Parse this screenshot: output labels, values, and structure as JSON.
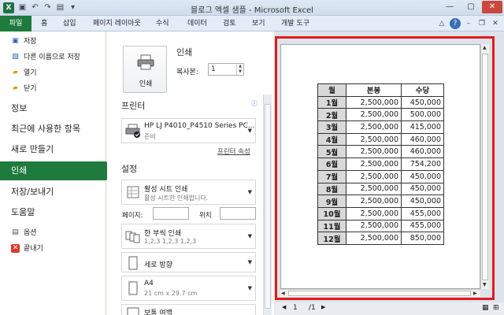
{
  "window": {
    "title": "블로그 엑셀 샘플 - Microsoft Excel",
    "app_icon": "X"
  },
  "ribbon": {
    "file_tab": "파일",
    "tabs": [
      "홈",
      "삽입",
      "페이지 레이아웃",
      "수식",
      "데이터",
      "검토",
      "보기",
      "개발 도구"
    ]
  },
  "backstage": {
    "save": "저장",
    "save_as": "다른 이름으로 저장",
    "open": "열기",
    "close": "닫기",
    "info": "정보",
    "recent": "최근에 사용한 항목",
    "new": "새로 만들기",
    "print": "인쇄",
    "save_send": "저장/보내기",
    "help": "도움말",
    "options": "옵션",
    "exit": "끝내기"
  },
  "print_pane": {
    "heading": "인쇄",
    "print_button": "인쇄",
    "copies_label": "복사본:",
    "copies_value": "1",
    "printer_heading": "프린터",
    "printer_name": "HP LJ P4010_P4510 Series PC...",
    "printer_status": "준비",
    "printer_properties": "프린터 속성",
    "settings_heading": "설정",
    "scope_main": "활성 시트 인쇄",
    "scope_sub": "활성 시트만 인쇄합니다.",
    "pages_label": "페이지:",
    "to_label": "위치",
    "collate_main": "한 부씩 인쇄",
    "collate_sub": "1,2,3    1,2,3    1,2,3",
    "orientation": "세로 방향",
    "paper_main": "A4",
    "paper_sub": "21 cm x 29.7 cm",
    "margins": "보통 여백"
  },
  "preview": {
    "headers": [
      "월",
      "본봉",
      "수당"
    ],
    "rows": [
      [
        "1월",
        "2,500,000",
        "450,000"
      ],
      [
        "2월",
        "2,500,000",
        "500,000"
      ],
      [
        "3월",
        "2,500,000",
        "415,000"
      ],
      [
        "4월",
        "2,500,000",
        "460,000"
      ],
      [
        "5월",
        "2,500,000",
        "460,000"
      ],
      [
        "6월",
        "2,500,000",
        "754,200"
      ],
      [
        "7월",
        "2,500,000",
        "450,000"
      ],
      [
        "8월",
        "2,500,000",
        "450,000"
      ],
      [
        "9월",
        "2,500,000",
        "450,000"
      ],
      [
        "10월",
        "2,500,000",
        "455,000"
      ],
      [
        "11월",
        "2,500,000",
        "455,000"
      ],
      [
        "12월",
        "2,500,000",
        "850,000"
      ]
    ],
    "page_current": "1",
    "page_total": "/1"
  },
  "colors": {
    "accent_green": "#1f7a3d",
    "highlight_red": "#e21b1b"
  }
}
